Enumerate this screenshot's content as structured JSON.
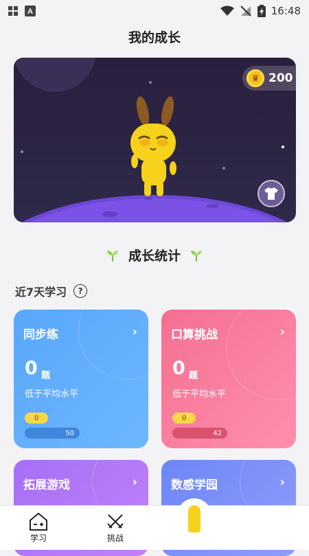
{
  "status_bar": {
    "time": "16:48"
  },
  "page": {
    "title": "我的成长"
  },
  "hero": {
    "coins": "200"
  },
  "stats": {
    "title": "成长统计"
  },
  "recent": {
    "label": "近7天学习"
  },
  "cards": [
    {
      "title": "同步练",
      "count": "0",
      "unit": "题",
      "level": "低于平均水平",
      "badge": "0",
      "progress_label": "50",
      "progress": 50
    },
    {
      "title": "口算挑战",
      "count": "0",
      "unit": "题",
      "level": "低于平均水平",
      "badge": "0",
      "progress_label": "42",
      "progress": 42
    },
    {
      "title": "拓展游戏"
    },
    {
      "title": "数感学园"
    }
  ],
  "nav": {
    "learn": "学习",
    "challenge": "挑战"
  },
  "colors": {
    "blue": "#59a7fb",
    "pink": "#f46f92",
    "purple": "#a56ff6",
    "indigo": "#6d86f7",
    "coin": "#f5c21b"
  }
}
